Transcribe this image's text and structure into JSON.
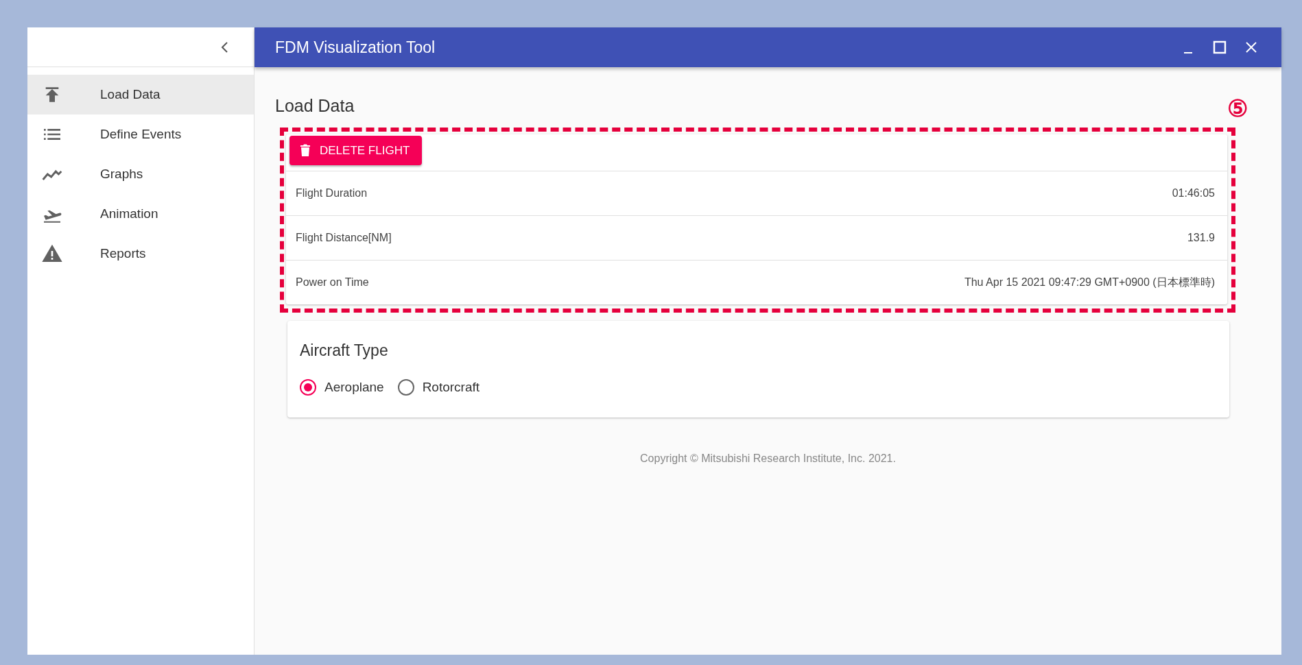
{
  "window": {
    "title": "FDM Visualization Tool"
  },
  "sidebar": {
    "items": [
      {
        "label": "Load Data",
        "selected": true
      },
      {
        "label": "Define Events",
        "selected": false
      },
      {
        "label": "Graphs",
        "selected": false
      },
      {
        "label": "Animation",
        "selected": false
      },
      {
        "label": "Reports",
        "selected": false
      }
    ]
  },
  "page_title": "Load Data",
  "annotation": {
    "label": "⑤"
  },
  "flight_card": {
    "button": "DELETE FLIGHT",
    "rows": [
      {
        "label": "Flight Duration",
        "value": "01:46:05"
      },
      {
        "label": "Flight Distance[NM]",
        "value": "131.9"
      },
      {
        "label": "Power on Time",
        "value": "Thu Apr 15 2021 09:47:29 GMT+0900 (日本標準時)"
      }
    ]
  },
  "aircraft_type": {
    "title": "Aircraft Type",
    "options": [
      {
        "label": "Aeroplane",
        "selected": true
      },
      {
        "label": "Rotorcraft",
        "selected": false
      }
    ]
  },
  "footer": "Copyright © Mitsubishi Research Institute, Inc. 2021."
}
